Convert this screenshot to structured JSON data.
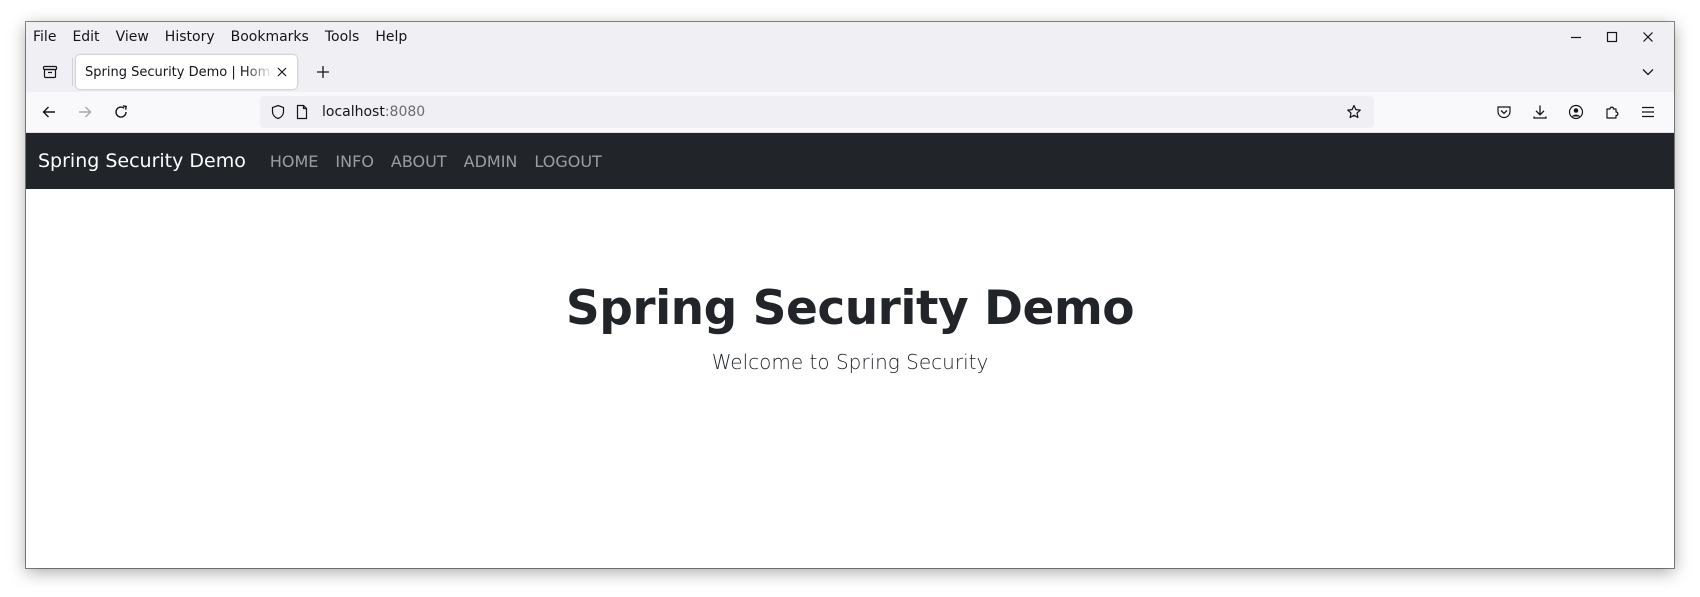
{
  "browser": {
    "menu": [
      "File",
      "Edit",
      "View",
      "History",
      "Bookmarks",
      "Tools",
      "Help"
    ],
    "tab": {
      "title": "Spring Security Demo | Home"
    },
    "url": {
      "host": "localhost",
      "port": ":8080"
    }
  },
  "site": {
    "brand": "Spring Security Demo",
    "nav": [
      "HOME",
      "INFO",
      "ABOUT",
      "ADMIN",
      "LOGOUT"
    ],
    "hero": {
      "title": "Spring Security Demo",
      "subtitle": "Welcome to Spring Security"
    }
  },
  "colors": {
    "navbar_bg": "#212529",
    "chrome_bg": "#f0f0f4",
    "text_dark": "#212529"
  }
}
